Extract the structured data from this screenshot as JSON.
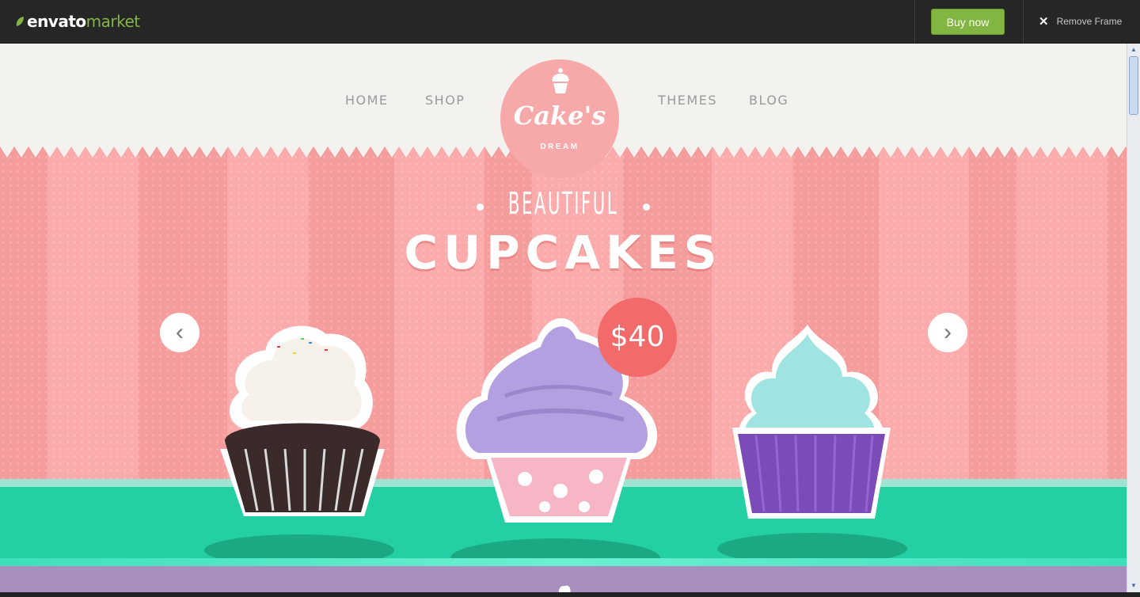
{
  "topbar": {
    "logo_primary": "envato",
    "logo_secondary": "market",
    "buy_label": "Buy now",
    "remove_label": "Remove Frame",
    "accent": "#82b541"
  },
  "site": {
    "nav": {
      "home": "HOME",
      "shop": "SHOP",
      "themes": "THEMES",
      "blog": "BLOG"
    },
    "brand": {
      "name": "Cake's",
      "tagline": "DREAM"
    },
    "hero": {
      "kicker": "BEAUTIFUL",
      "title": "CUPCAKES",
      "price": "$40",
      "prev_arrow": "‹",
      "next_arrow": "›"
    },
    "colors": {
      "pink": "#f7a8a8",
      "price": "#f36a6a",
      "mint": "#23cfa3",
      "lavender": "#a98fc0"
    }
  },
  "icons": [
    "leaf-icon",
    "close-icon",
    "cupcake-logo-icon",
    "chevron-left-icon",
    "chevron-right-icon",
    "scroll-up-icon",
    "scroll-down-icon"
  ]
}
